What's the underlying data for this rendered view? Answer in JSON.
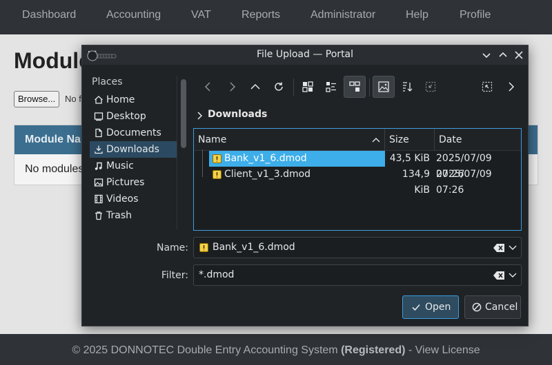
{
  "app": {
    "nav": [
      "Dashboard",
      "Accounting",
      "VAT",
      "Reports",
      "Administrator",
      "Help",
      "Profile"
    ],
    "page_title": "Modules",
    "browse_label": "Browse...",
    "no_file_label": "No file selected.",
    "panel_header": "Module Name",
    "panel_empty": "No modules installed",
    "footer_prefix": "© 2025 DONNOTEC Double Entry Accounting System",
    "footer_bold": "(Registered)",
    "footer_suffix": "- View License"
  },
  "dialog": {
    "title": "File Upload — Portal",
    "places_heading": "Places",
    "places": [
      {
        "label": "Home",
        "icon": "home-icon"
      },
      {
        "label": "Desktop",
        "icon": "desktop-icon"
      },
      {
        "label": "Documents",
        "icon": "documents-icon"
      },
      {
        "label": "Downloads",
        "icon": "downloads-icon",
        "active": true
      },
      {
        "label": "Music",
        "icon": "music-icon"
      },
      {
        "label": "Pictures",
        "icon": "pictures-icon"
      },
      {
        "label": "Videos",
        "icon": "videos-icon"
      },
      {
        "label": "Trash",
        "icon": "trash-icon"
      }
    ],
    "breadcrumb": "Downloads",
    "columns": {
      "name": "Name",
      "size": "Size",
      "date": "Date"
    },
    "files": [
      {
        "name": "Bank_v1_6.dmod",
        "size": "43,5 KiB",
        "date": "2025/07/09 07:26",
        "selected": true
      },
      {
        "name": "Client_v1_3.dmod",
        "size": "134,9 KiB",
        "date": "2025/07/09 07:26",
        "selected": false
      }
    ],
    "name_label": "Name:",
    "name_value": "Bank_v1_6.dmod",
    "filter_label": "Filter:",
    "filter_value": "*.dmod",
    "open_label": "Open",
    "cancel_label": "Cancel",
    "accent": "#3daee9"
  }
}
